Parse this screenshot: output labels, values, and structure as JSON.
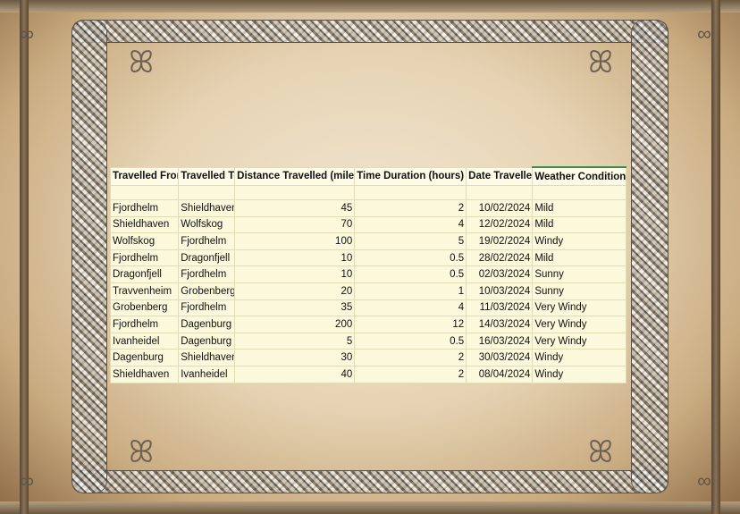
{
  "table": {
    "headers": {
      "from": "Travelled From",
      "to": "Travelled To",
      "distance": "Distance Travelled (miles)",
      "time": "Time Duration (hours)",
      "date": "Date Travelled",
      "weather": "Weather Conditions"
    },
    "rows": [
      {
        "from": "Fjordhelm",
        "to": "Shieldhaven",
        "distance": "45",
        "time": "2",
        "date": "10/02/2024",
        "weather": "Mild"
      },
      {
        "from": "Shieldhaven",
        "to": "Wolfskog",
        "distance": "70",
        "time": "4",
        "date": "12/02/2024",
        "weather": "Mild"
      },
      {
        "from": "Wolfskog",
        "to": "Fjordhelm",
        "distance": "100",
        "time": "5",
        "date": "19/02/2024",
        "weather": "Windy"
      },
      {
        "from": "Fjordhelm",
        "to": "Dragonfjell",
        "distance": "10",
        "time": "0.5",
        "date": "28/02/2024",
        "weather": "Mild"
      },
      {
        "from": "Dragonfjell",
        "to": "Fjordhelm",
        "distance": "10",
        "time": "0.5",
        "date": "02/03/2024",
        "weather": "Sunny"
      },
      {
        "from": "Travvenheim",
        "to": "Grobenberg",
        "distance": "20",
        "time": "1",
        "date": "10/03/2024",
        "weather": "Sunny"
      },
      {
        "from": "Grobenberg",
        "to": "Fjordhelm",
        "distance": "35",
        "time": "4",
        "date": "11/03/2024",
        "weather": "Very Windy"
      },
      {
        "from": "Fjordhelm",
        "to": "Dagenburg",
        "distance": "200",
        "time": "12",
        "date": "14/03/2024",
        "weather": "Very Windy"
      },
      {
        "from": "Ivanheidel",
        "to": "Dagenburg",
        "distance": "5",
        "time": "0.5",
        "date": "16/03/2024",
        "weather": "Very Windy"
      },
      {
        "from": "Dagenburg",
        "to": "Shieldhaven",
        "distance": "30",
        "time": "2",
        "date": "30/03/2024",
        "weather": "Windy"
      },
      {
        "from": "Shieldhaven",
        "to": "Ivanheidel",
        "distance": "40",
        "time": "2",
        "date": "08/04/2024",
        "weather": "Windy"
      }
    ]
  },
  "colors": {
    "cell_fill": "#fbf8dc",
    "gridline": "#e0dcb4",
    "selection_accent": "#3d8a4a"
  },
  "icons": {
    "corner": "celtic-knot-icon",
    "border": "braided-knot-border"
  }
}
